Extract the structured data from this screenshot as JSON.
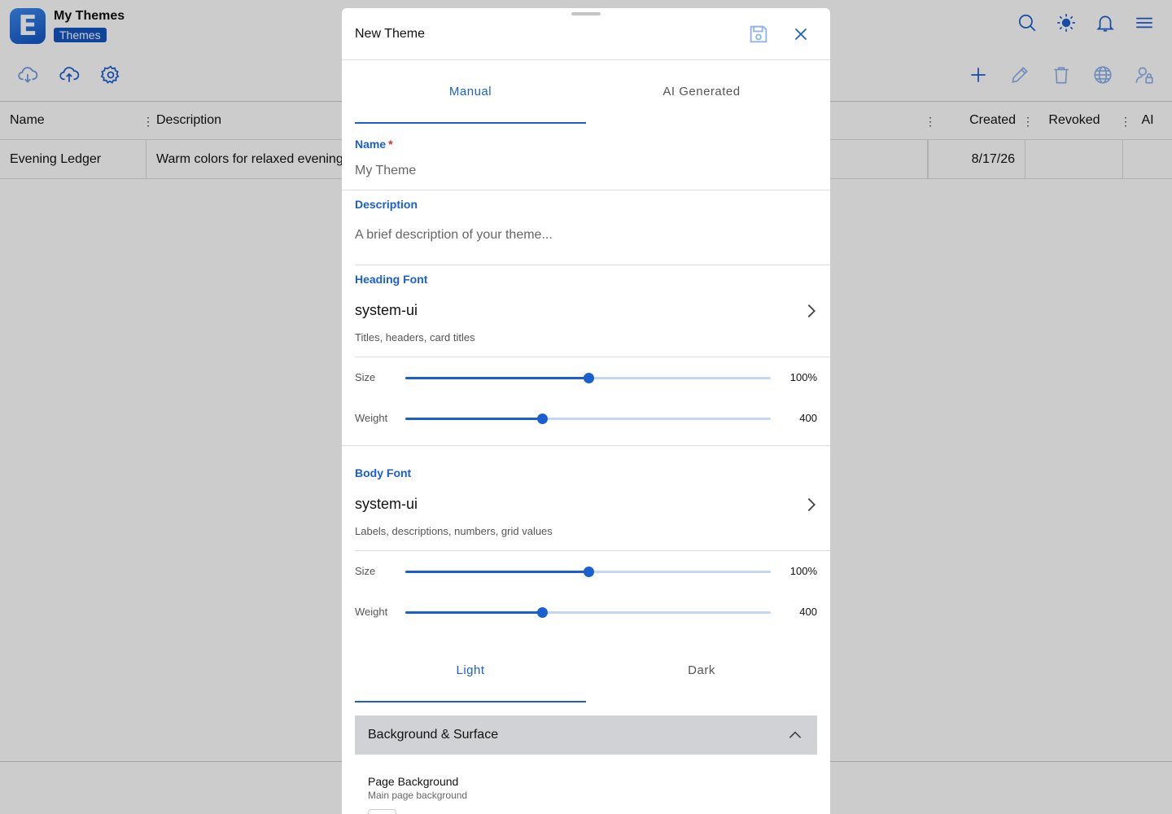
{
  "app": {
    "title": "My Themes",
    "badge": "Themes",
    "logo_letter": "E",
    "top_icons": [
      "search-icon",
      "sun-icon",
      "bell-icon",
      "menu-icon"
    ],
    "toolbar_left_icons": [
      "cloud-download-icon",
      "cloud-upload-icon",
      "settings-icon"
    ],
    "toolbar_right_icons": [
      "plus-icon",
      "pencil-icon",
      "trash-icon",
      "globe-icon",
      "user-lock-icon"
    ]
  },
  "grid": {
    "columns": [
      "Name",
      "Description",
      "Created",
      "Revoked",
      "AI"
    ],
    "rows": [
      {
        "name": "Evening Ledger",
        "description": "Warm colors for relaxed evening",
        "created": "8/17/26",
        "revoked": "",
        "ai": ""
      }
    ]
  },
  "modal": {
    "title": "New Theme",
    "tabs": [
      {
        "label": "Manual",
        "active": true
      },
      {
        "label": "AI Generated",
        "active": false
      }
    ],
    "name_field": {
      "label": "Name",
      "required_mark": "*",
      "value": "",
      "placeholder": "My Theme"
    },
    "description_field": {
      "label": "Description",
      "value": "",
      "placeholder": "A brief description of your theme..."
    },
    "heading_font": {
      "label": "Heading Font",
      "value": "system-ui",
      "hint": "Titles, headers, card titles",
      "size": {
        "label": "Size",
        "value": "100%",
        "fraction": 0.5
      },
      "weight": {
        "label": "Weight",
        "value": "400",
        "fraction": 0.375
      }
    },
    "body_font": {
      "label": "Body Font",
      "value": "system-ui",
      "hint": "Labels, descriptions, numbers, grid values",
      "size": {
        "label": "Size",
        "value": "100%",
        "fraction": 0.5
      },
      "weight": {
        "label": "Weight",
        "value": "400",
        "fraction": 0.375
      }
    },
    "mode_tabs": [
      {
        "label": "Light",
        "active": true
      },
      {
        "label": "Dark",
        "active": false
      }
    ],
    "section": {
      "title": "Background & Surface",
      "expanded": true,
      "items": [
        {
          "title": "Page Background",
          "description": "Main page background"
        }
      ]
    }
  },
  "colors": {
    "accent": "#1a5fd0",
    "required": "#d32f2f",
    "section_bg": "#d0d2d5"
  }
}
